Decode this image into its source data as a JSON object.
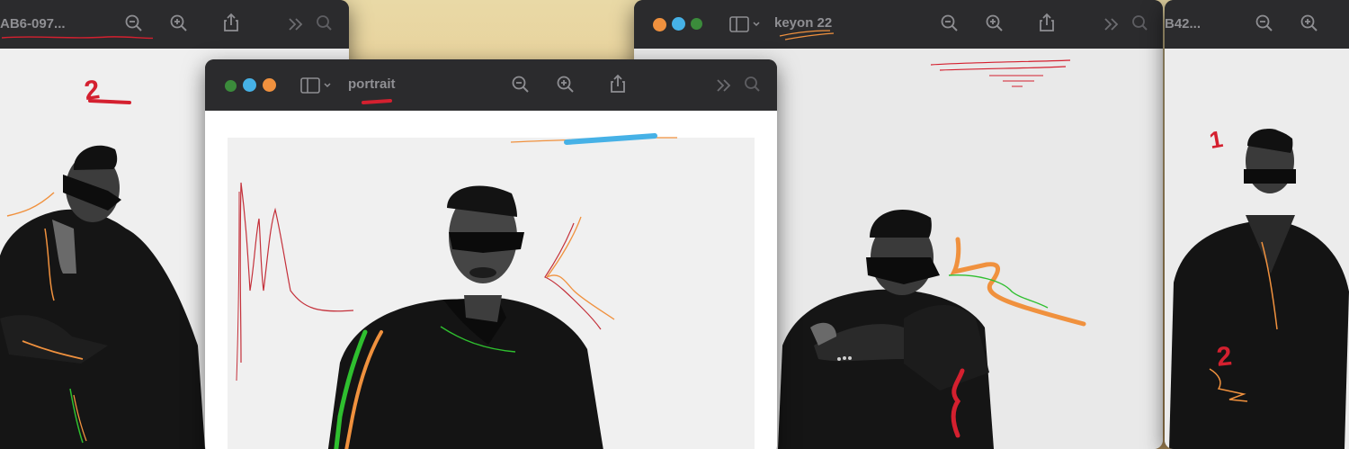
{
  "colors": {
    "titlebar": "#2b2b2d",
    "title_text": "#8f8f93",
    "tool_icon": "#8e8e92",
    "annotation_red": "#d4202f",
    "annotation_orange": "#f0913e",
    "annotation_green": "#2fbf2f",
    "annotation_blue": "#46b1e6"
  },
  "windows": {
    "far_left": {
      "title": "AB6-097...",
      "toolbar_icons": [
        "zoom-out-icon",
        "zoom-in-icon",
        "share-icon",
        "more-chevron-icon",
        "search-icon"
      ],
      "markup_text": "2"
    },
    "portrait": {
      "title": "portrait",
      "tag_dots": [
        "green",
        "blue",
        "orange"
      ],
      "toolbar_icons": [
        "sidebar-icon",
        "zoom-out-icon",
        "zoom-in-icon",
        "share-icon",
        "more-chevron-icon",
        "search-icon"
      ]
    },
    "keyon": {
      "title": "keyon 22",
      "tag_dots": [
        "orange",
        "blue",
        "green"
      ],
      "toolbar_icons": [
        "sidebar-icon",
        "zoom-out-icon",
        "zoom-in-icon",
        "share-icon",
        "more-chevron-icon",
        "search-icon"
      ]
    },
    "far_right": {
      "title": "B42...",
      "toolbar_icons": [
        "zoom-out-icon",
        "zoom-in-icon"
      ],
      "markup_text_top": "1",
      "markup_text_bottom": "2"
    }
  }
}
